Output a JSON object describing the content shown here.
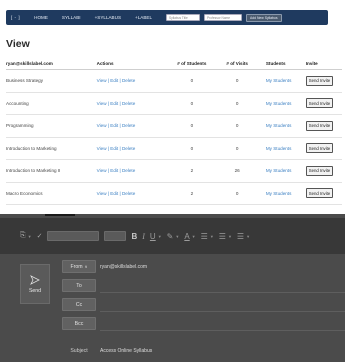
{
  "nav": {
    "brand": "[ - ]",
    "links": [
      "HOME",
      "SYLLABI",
      "+SYLLABUS",
      "+LABEL"
    ],
    "input1_placeholder": "Syllabus Title",
    "input2_placeholder": "Professor Name",
    "button": "Add New Syllabus"
  },
  "page_title": "View",
  "table": {
    "headers": [
      "ryan@skillslabel.com",
      "Actions",
      "# of Students",
      "# of Visits",
      "Students",
      "Invite"
    ],
    "action_labels": [
      "View",
      "Edit",
      "Delete"
    ],
    "separator": "|",
    "students_link": "My Students",
    "invite_label": "Send Invite",
    "rows": [
      {
        "name": "Business Strategy",
        "students": "0",
        "visits": "0"
      },
      {
        "name": "Accounting",
        "students": "0",
        "visits": "0"
      },
      {
        "name": "Programming",
        "students": "0",
        "visits": "0"
      },
      {
        "name": "Introduction to Marketing",
        "students": "0",
        "visits": "0"
      },
      {
        "name": "Introduction to Marketing II",
        "students": "2",
        "visits": "26"
      },
      {
        "name": "Macro Economics",
        "students": "2",
        "visits": "0"
      }
    ]
  },
  "compose": {
    "send_label": "Send",
    "from_label": "From",
    "from_value": "ryan@skillslabel.com",
    "to_label": "To",
    "cc_label": "Cc",
    "bcc_label": "Bcc",
    "subject_label": "Subject",
    "subject_value": "Access Online Syllabus"
  }
}
